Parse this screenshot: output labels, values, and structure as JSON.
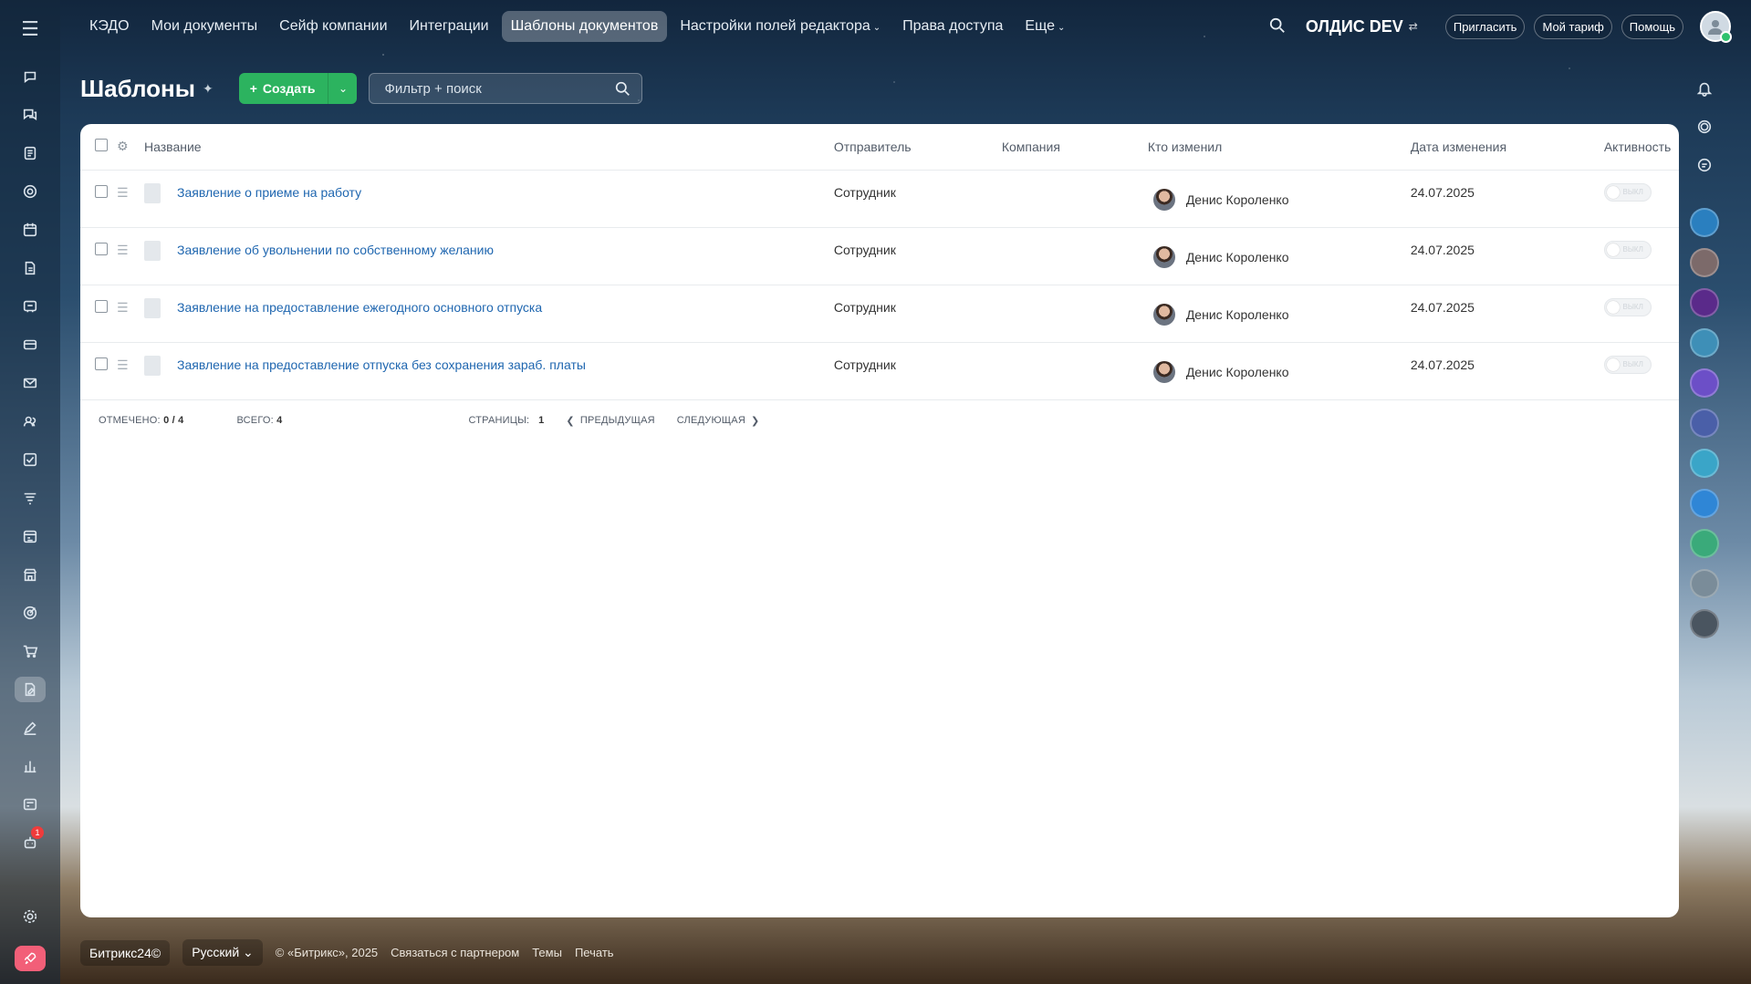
{
  "topnav": {
    "items": [
      {
        "label": "КЭДО"
      },
      {
        "label": "Мои документы"
      },
      {
        "label": "Сейф компании"
      },
      {
        "label": "Интеграции"
      },
      {
        "label": "Шаблоны документов",
        "active": true
      },
      {
        "label": "Настройки полей редактора",
        "dropdown": true
      },
      {
        "label": "Права доступа"
      },
      {
        "label": "Еще",
        "dropdown": true
      }
    ],
    "company": "ОЛДИС DEV",
    "invite": "Пригласить",
    "tariff": "Мой тариф",
    "help": "Помощь"
  },
  "page": {
    "title": "Шаблоны",
    "create_label": "Создать",
    "filter_placeholder": "Фильтр + поиск"
  },
  "table": {
    "columns": [
      "Название",
      "Отправитель",
      "Компания",
      "Кто изменил",
      "Дата изменения",
      "Активность"
    ],
    "rows": [
      {
        "name": "Заявление о приеме на работу",
        "sender": "Сотрудник",
        "company": "",
        "modified_by": "Денис Короленко",
        "date": "24.07.2025",
        "active": false
      },
      {
        "name": "Заявление об увольнении по собственному желанию",
        "sender": "Сотрудник",
        "company": "",
        "modified_by": "Денис Короленко",
        "date": "24.07.2025",
        "active": false
      },
      {
        "name": "Заявление на предоставление ежегодного основного отпуска",
        "sender": "Сотрудник",
        "company": "",
        "modified_by": "Денис Короленко",
        "date": "24.07.2025",
        "active": false
      },
      {
        "name": "Заявление на предоставление отпуска без сохранения зараб. платы",
        "sender": "Сотрудник",
        "company": "",
        "modified_by": "Денис Короленко",
        "date": "24.07.2025",
        "active": false
      }
    ],
    "toggle_label": "ВЫКЛ"
  },
  "list_footer": {
    "marked_label": "Отмечено:",
    "marked_value": "0 / 4",
    "total_label": "Всего:",
    "total_value": "4",
    "pages_label": "Страницы:",
    "pages_value": "1",
    "prev": "Предыдущая",
    "next": "Следующая"
  },
  "footer": {
    "brand": "Битрикс24©",
    "language": "Русский",
    "copyright": "© «Битрикс», 2025",
    "partner": "Связаться с партнером",
    "themes": "Темы",
    "print": "Печать"
  },
  "left_rail": {
    "icons": [
      "chat-icon",
      "messages-icon",
      "feed-icon",
      "tasks-ring-icon",
      "calendar-icon",
      "docs-icon",
      "crm-icon",
      "wallet-icon",
      "mail-icon",
      "contacts-icon",
      "checklist-icon",
      "funnel-icon",
      "projects-icon",
      "store-icon",
      "goals-icon",
      "shop-icon",
      "sign-icon",
      "pen-icon",
      "analytics-icon",
      "cashbox-icon",
      "robot-icon"
    ],
    "active": "sign-icon",
    "badge": "1"
  },
  "colors": {
    "accent_green": "#2cb35f",
    "link_blue": "#2067b0"
  }
}
